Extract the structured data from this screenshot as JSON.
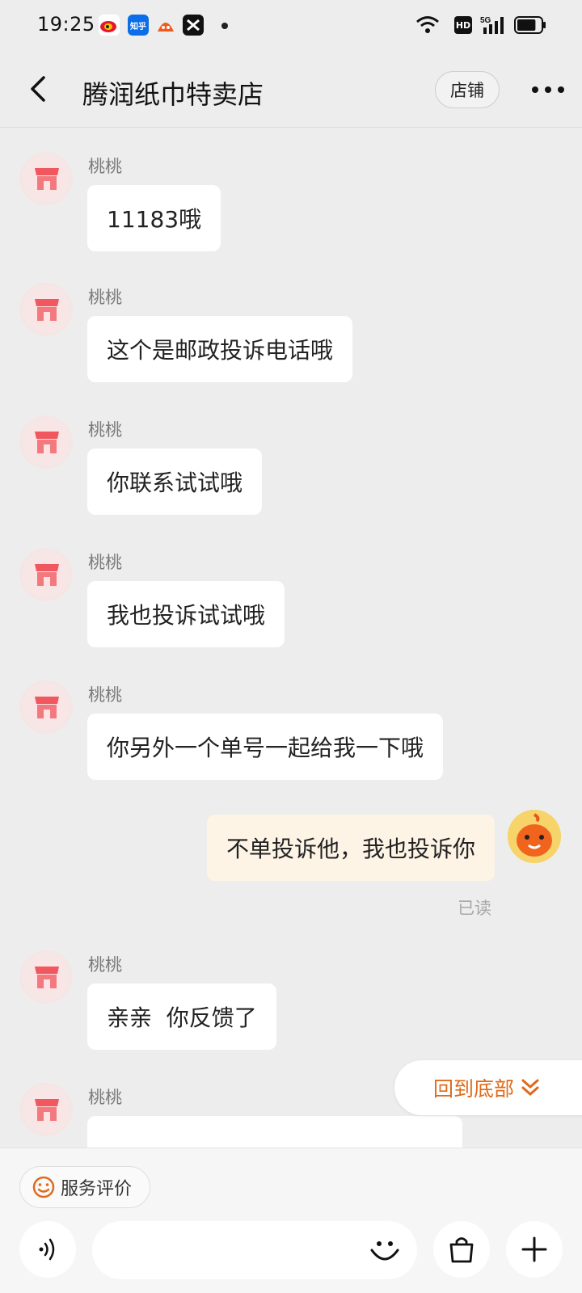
{
  "status_bar": {
    "time": "19:25",
    "app_icons": [
      "weibo-icon",
      "zhihu-icon",
      "taobao-icon",
      "capcut-icon"
    ],
    "zhihu_label": "知乎",
    "hd_label": "HD",
    "network_label": "5G",
    "battery_level": 0.8
  },
  "header": {
    "title": "腾润纸巾特卖店",
    "shop_button": "店铺"
  },
  "messages": [
    {
      "side": "left",
      "sender": "桃桃",
      "text": "11183哦"
    },
    {
      "side": "left",
      "sender": "桃桃",
      "text": "这个是邮政投诉电话哦"
    },
    {
      "side": "left",
      "sender": "桃桃",
      "text": "你联系试试哦"
    },
    {
      "side": "left",
      "sender": "桃桃",
      "text": "我也投诉试试哦"
    },
    {
      "side": "left",
      "sender": "桃桃",
      "text": "你另外一个单号一起给我一下哦"
    },
    {
      "side": "right",
      "text": "不单投诉他，我也投诉你",
      "status": "已读"
    },
    {
      "side": "left",
      "sender": "桃桃",
      "text": "亲亲  你反馈了"
    },
    {
      "side": "left",
      "sender": "桃桃",
      "text": ""
    }
  ],
  "back_to_bottom": "回到底部",
  "bottom_bar": {
    "service_rating": "服务评价",
    "input_placeholder": ""
  },
  "colors": {
    "accent": "#e06a1a",
    "background": "#ededed",
    "my_bubble": "#fdf4e6"
  }
}
